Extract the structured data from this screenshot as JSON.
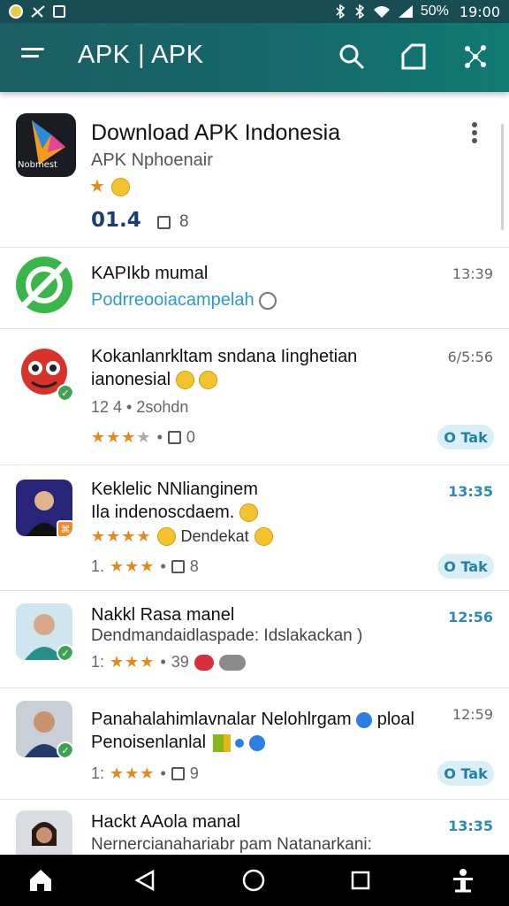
{
  "status_bar": {
    "battery": "50%",
    "time": "19:00"
  },
  "app_bar": {
    "title": "APK | APK",
    "icons": [
      "menu-icon",
      "search-icon",
      "tag-icon",
      "scatter-icon"
    ]
  },
  "featured": {
    "title": "Download APK Indonesia",
    "subtitle": "APK Nphoenair",
    "logo_text": "Nobmest",
    "rating": "01.4",
    "count": "8"
  },
  "rows": [
    {
      "title": "KAPIkb mumal",
      "subtitle": "Podrreooiacampelah",
      "time": "13:39"
    },
    {
      "title": "Kokanlanrkltam sndana Iinghetian",
      "title2": "ianonesial",
      "meta": "12 4 • 2sohdn",
      "time": "6/5:56",
      "count": "0",
      "action": "O Tak"
    },
    {
      "title": "Keklelic NNlianginem",
      "title2": "Ila indenoscdaem.",
      "rating_text": "Dendekat",
      "meta_prefix": "1.",
      "count": "8",
      "time": "13:35",
      "action": "O Tak"
    },
    {
      "title": "Nakkl Rasa manel",
      "subtitle": "Dendmandaidlaspade: Idslakackan )",
      "meta_prefix": "1:",
      "count": "39",
      "time": "12:56"
    },
    {
      "title": "Panahalahimlavnalar Nelohlrgam",
      "title_suffix": "ploal",
      "subtitle": "Penoisenlanlal",
      "meta_prefix": "1:",
      "count": "9",
      "time": "12:59",
      "action": "O Tak"
    },
    {
      "title": "Hackt AAola manal",
      "subtitle": "Nernercianahariabr pam Natanarkani:",
      "time": "13:35"
    }
  ],
  "colors": {
    "appbar": "#15686b",
    "accent": "#2a8cb3",
    "star": "#e28a1c",
    "pill_bg": "#d9eef5"
  }
}
